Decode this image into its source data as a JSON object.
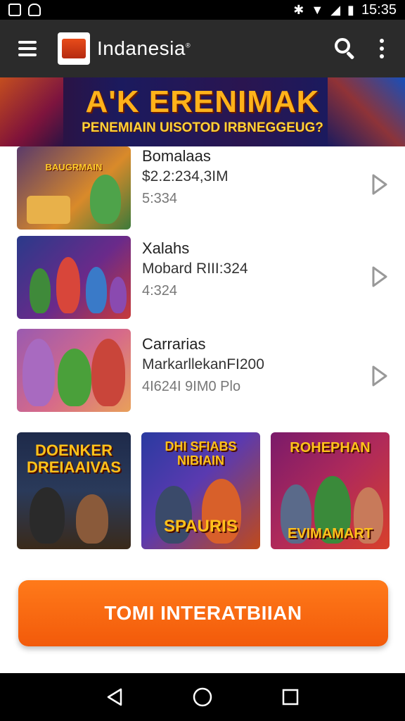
{
  "status_bar": {
    "time": "15:35",
    "left_icons": [
      "notification-icon",
      "android-icon"
    ],
    "right_icons": [
      "bluetooth-icon",
      "wifi-icon",
      "signal-icon",
      "battery-icon"
    ]
  },
  "app_bar": {
    "title": "Indanesia",
    "title_mark": "®",
    "icons": [
      "menu-icon",
      "app-logo",
      "search-icon",
      "more-vert-icon"
    ]
  },
  "banner": {
    "title": "A'K ERENIMAK",
    "subtitle": "PENEMIAIN UISOTOD IRBNEGGEUG?"
  },
  "list": [
    {
      "title": "Bomalaas",
      "subtitle": "$2.2:234,3IM",
      "meta": "5:334",
      "thumb_text": "BAUGRMAIN",
      "colors": [
        "#5a3a6a",
        "#d98a2a",
        "#3c7a3a"
      ]
    },
    {
      "title": "Xalahs",
      "subtitle": "Mobard RIII:324",
      "meta": "4:324",
      "thumb_text": "",
      "colors": [
        "#2a3a8a",
        "#6a2a8a",
        "#c73a3a"
      ]
    },
    {
      "title": "Carrarias",
      "subtitle": "MarkarllekanFI200",
      "meta": "4I624I 9IM0   Plo",
      "thumb_text": "",
      "colors": [
        "#9a5ab0",
        "#d66a8a",
        "#4aa03a"
      ]
    }
  ],
  "tiles": [
    {
      "title": "DOENKER DREIAAIVAS",
      "sub": "",
      "colors": [
        "#1e2a4a",
        "#3a2a1a"
      ]
    },
    {
      "title": "DHI SFIABS NIBIAIN",
      "sub": "SPAURIS",
      "colors": [
        "#2a3aa0",
        "#c04a1a"
      ]
    },
    {
      "title": "ROHEPHAN",
      "sub": "EVIMAMART",
      "colors": [
        "#7a1a6a",
        "#d8402a"
      ]
    }
  ],
  "cta": {
    "label": "TOMI INTERATBIIAN",
    "color": "#f25a0a"
  },
  "nav_bar": {
    "icons": [
      "back-icon",
      "home-icon",
      "recents-icon"
    ]
  }
}
